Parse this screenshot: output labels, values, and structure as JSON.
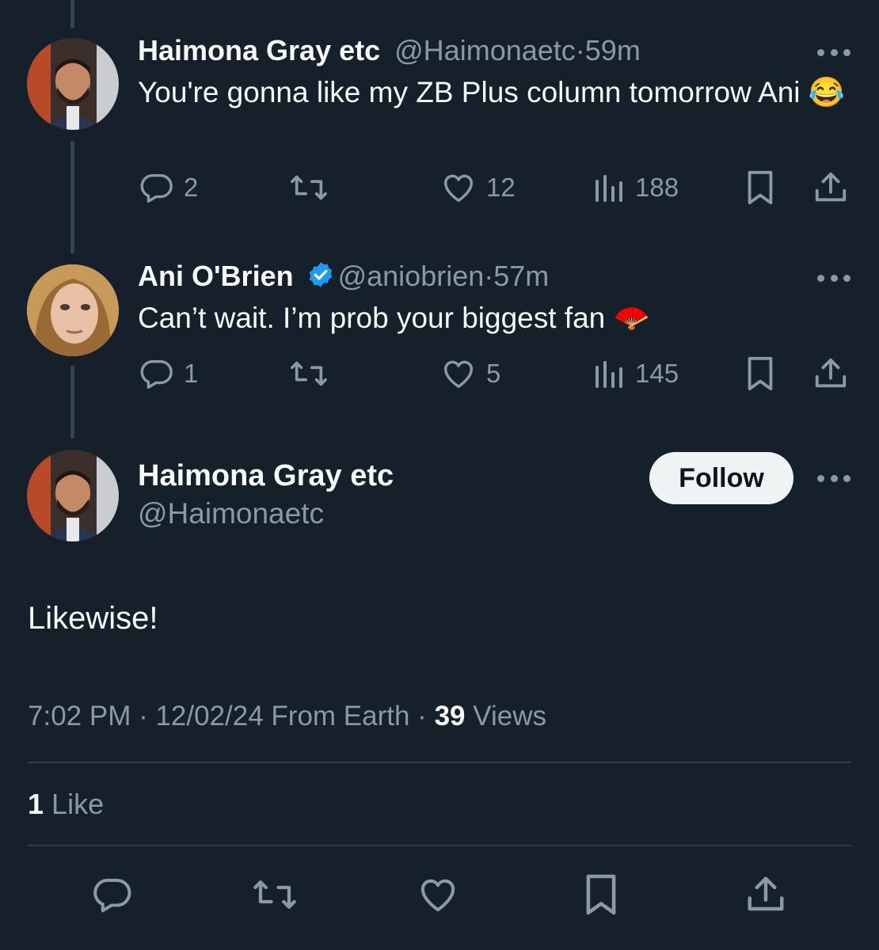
{
  "tweets": [
    {
      "name": "Haimona Gray etc",
      "handle": "@Haimonaetc",
      "separator": "·",
      "time": "59m",
      "text": "You're gonna like my ZB Plus column tomorrow Ani 😂",
      "replies": "2",
      "likes": "12",
      "views": "188"
    },
    {
      "name": "Ani O'Brien",
      "handle": "@aniobrien",
      "separator": "·",
      "time": "57m",
      "text": "Can’t wait. I’m prob your biggest fan 🪭",
      "replies": "1",
      "likes": "5",
      "views": "145"
    }
  ],
  "main": {
    "name": "Haimona Gray etc",
    "handle": "@Haimonaetc",
    "follow_label": "Follow",
    "text": "Likewise!",
    "timestamp": "7:02 PM · 12/02/24 From Earth ·",
    "views_count": "39",
    "views_label": "Views",
    "likes_count": "1",
    "likes_label": "Like"
  },
  "colors": {
    "background": "#15202b",
    "text": "#f7f9f9",
    "muted": "#8b98a5",
    "verified": "#1d9bf0",
    "divider": "#2f3b45"
  },
  "icons": [
    "reply-icon",
    "retweet-icon",
    "like-icon",
    "views-icon",
    "bookmark-icon",
    "share-icon",
    "more-icon",
    "verified-badge-icon"
  ]
}
